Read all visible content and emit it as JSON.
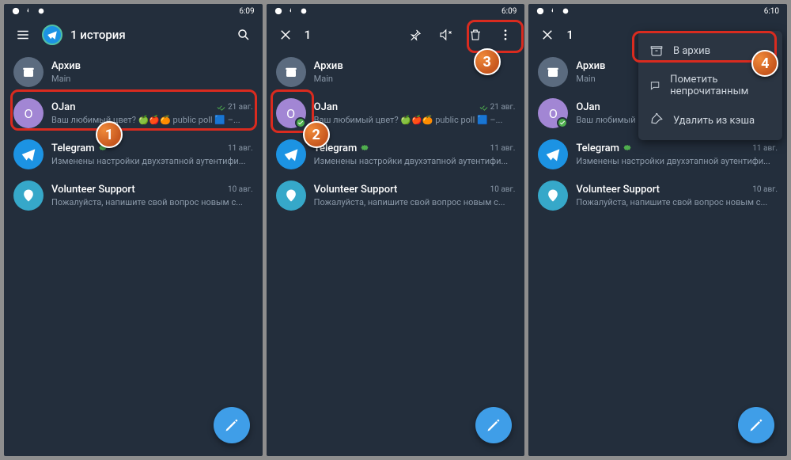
{
  "status": {
    "time1": "6:09",
    "time2": "6:09",
    "time3": "6:10"
  },
  "header": {
    "title": "1 история",
    "selectionCount": "1"
  },
  "archive": {
    "label": "Архив",
    "sub": "Main"
  },
  "chats": {
    "ojan": {
      "name": "OJan",
      "date": "21 авг.",
      "sub": "Ваш любимый цвет? 🍏🍎🍊 public poll  🟦 –...",
      "initial": "O"
    },
    "telegram": {
      "name": "Telegram",
      "date": "11 авг.",
      "sub": "Изменены настройки двухэтапной аутентифи..."
    },
    "support": {
      "name": "Volunteer Support",
      "date": "10 авг.",
      "sub": "Пожалуйста, напишите свой вопрос новым с..."
    }
  },
  "menu": {
    "archive": "В архив",
    "unread": "Пометить непрочитанным",
    "cache": "Удалить из кэша"
  },
  "steps": {
    "s1": "1",
    "s2": "2",
    "s3": "3",
    "s4": "4"
  }
}
